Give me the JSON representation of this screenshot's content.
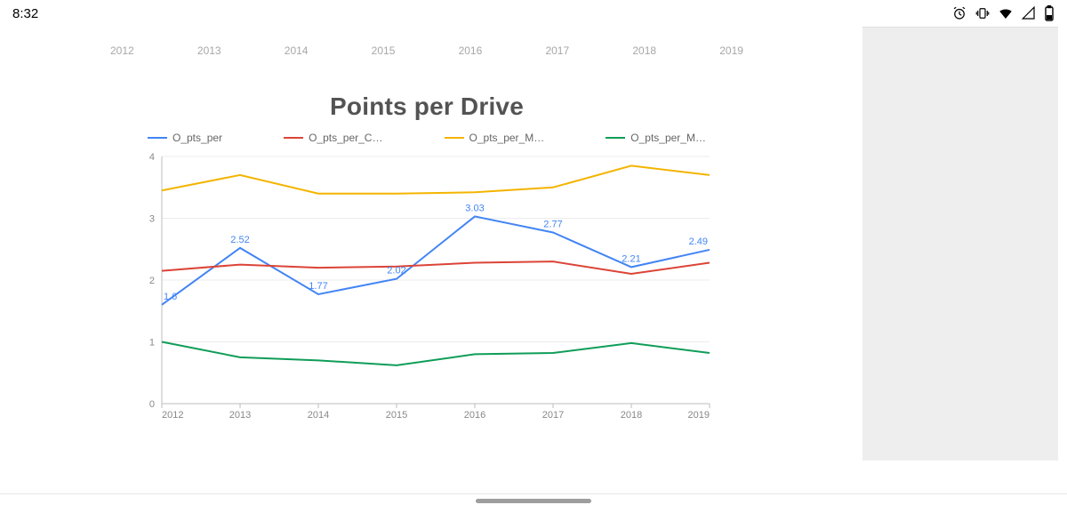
{
  "status": {
    "time": "8:32"
  },
  "year_tabs": [
    "2012",
    "2013",
    "2014",
    "2015",
    "2016",
    "2017",
    "2018",
    "2019"
  ],
  "chart_data": {
    "type": "line",
    "title": "Points per Drive",
    "xlabel": "",
    "ylabel": "",
    "ylim": [
      0,
      4
    ],
    "yticks": [
      0,
      1,
      2,
      3,
      4
    ],
    "categories": [
      "2012",
      "2013",
      "2014",
      "2015",
      "2016",
      "2017",
      "2018",
      "2019"
    ],
    "series": [
      {
        "name": "O_pts_per",
        "color": "#4285f4",
        "values": [
          1.6,
          2.52,
          1.77,
          2.02,
          3.03,
          2.77,
          2.21,
          2.49
        ],
        "labels": [
          "1.6",
          "2.52",
          "1.77",
          "2.02",
          "3.03",
          "2.77",
          "2.21",
          "2.49"
        ]
      },
      {
        "name": "O_pts_per_C…",
        "color": "#db4437",
        "values": [
          2.15,
          2.25,
          2.2,
          2.22,
          2.28,
          2.3,
          2.1,
          2.28
        ]
      },
      {
        "name": "O_pts_per_M…",
        "color": "#f4b400",
        "values": [
          3.45,
          3.7,
          3.4,
          3.4,
          3.42,
          3.5,
          3.85,
          3.7
        ]
      },
      {
        "name": "O_pts_per_M…",
        "color": "#0f9d58",
        "values": [
          1.0,
          0.75,
          0.7,
          0.62,
          0.8,
          0.82,
          0.98,
          0.82
        ]
      }
    ],
    "legend_position": "top"
  }
}
